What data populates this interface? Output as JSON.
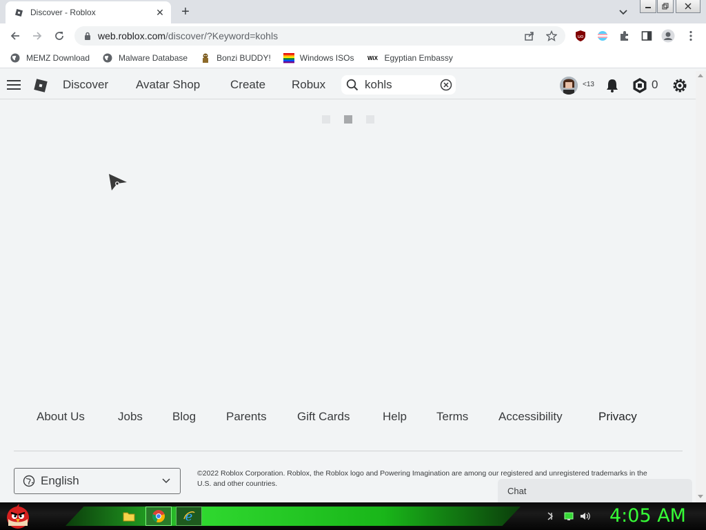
{
  "browser": {
    "tab": {
      "title": "Discover - Roblox",
      "close": "✕"
    },
    "new_tab": "+",
    "url_host": "web.roblox.com",
    "url_path": "/discover/?Keyword=kohls",
    "bookmarks": [
      {
        "label": "MEMZ Download",
        "icon": "globe-icon"
      },
      {
        "label": "Malware Database",
        "icon": "globe-icon"
      },
      {
        "label": "Bonzi BUDDY!",
        "icon": "bonzi-icon"
      },
      {
        "label": "Windows ISOs",
        "icon": "windows-icon"
      },
      {
        "label": "Egyptian Embassy",
        "icon": "wix-icon"
      }
    ],
    "wix_text": "WiX"
  },
  "header": {
    "nav": [
      "Discover",
      "Avatar Shop",
      "Create",
      "Robux"
    ],
    "search_value": "kohls",
    "age_label": "<13",
    "robux_count": "0"
  },
  "footer": {
    "links": [
      "About Us",
      "Jobs",
      "Blog",
      "Parents",
      "Gift Cards",
      "Help",
      "Terms",
      "Accessibility",
      "Privacy"
    ],
    "language": "English",
    "copyright": "©2022 Roblox Corporation. Roblox, the Roblox logo and Powering Imagination are among our registered and unregistered trademarks in the U.S. and other countries."
  },
  "chat": {
    "label": "Chat"
  },
  "taskbar": {
    "clock": "4:05 AM"
  },
  "colors": {
    "accent_green": "#36ff36",
    "roblox_text": "#393b3d"
  }
}
